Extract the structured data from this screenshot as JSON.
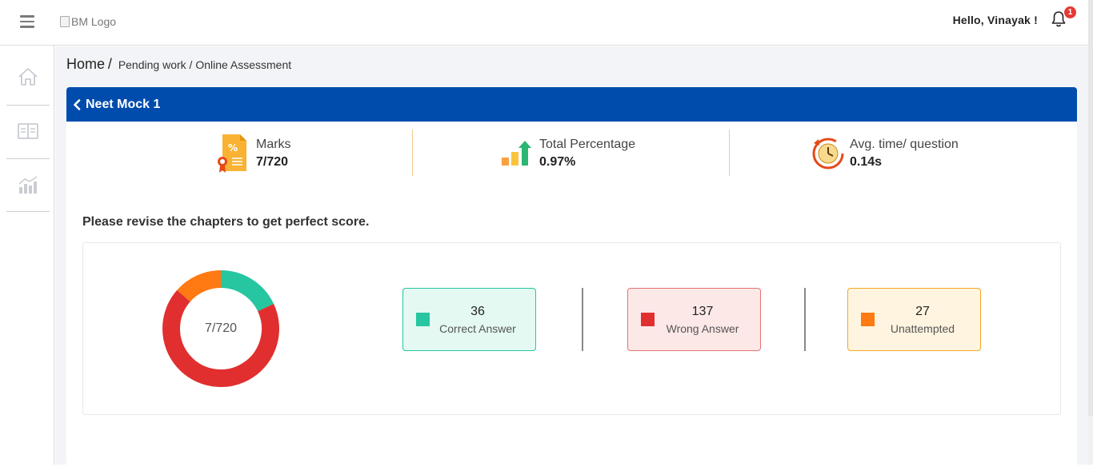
{
  "topbar": {
    "logo_alt": "BM Logo",
    "greeting": "Hello, Vinayak !",
    "notification_count": "1"
  },
  "sidebar": {
    "items": [
      {
        "icon": "home-icon"
      },
      {
        "icon": "book-icon"
      },
      {
        "icon": "analytics-icon"
      }
    ]
  },
  "breadcrumb": {
    "home": "Home",
    "separator": "/",
    "pending": "Pending work",
    "sep2": "/",
    "current": "Online Assessment"
  },
  "card": {
    "title": "Neet Mock 1"
  },
  "stats": {
    "marks": {
      "label": "Marks",
      "value": "7/720"
    },
    "percentage": {
      "label": "Total Percentage",
      "value": "0.97%"
    },
    "avg_time": {
      "label": "Avg. time/ question",
      "value": "0.14s"
    }
  },
  "revise_message": "Please revise the chapters to get perfect score.",
  "summary": {
    "center_label": "7/720",
    "correct": {
      "count": "36",
      "label": "Correct Answer",
      "color": "#26c6a0",
      "bg": "#e3f9f2",
      "border": "#26c6a0"
    },
    "wrong": {
      "count": "137",
      "label": "Wrong Answer",
      "color": "#e12f2f",
      "bg": "#fde8e8",
      "border": "#e57373"
    },
    "unattempted": {
      "count": "27",
      "label": "Unattempted",
      "color": "#ff7a12",
      "bg": "#fff4e0",
      "border": "#f5a623"
    }
  },
  "colors": {
    "header_blue": "#004cad",
    "content_bg": "#f3f4f7"
  }
}
